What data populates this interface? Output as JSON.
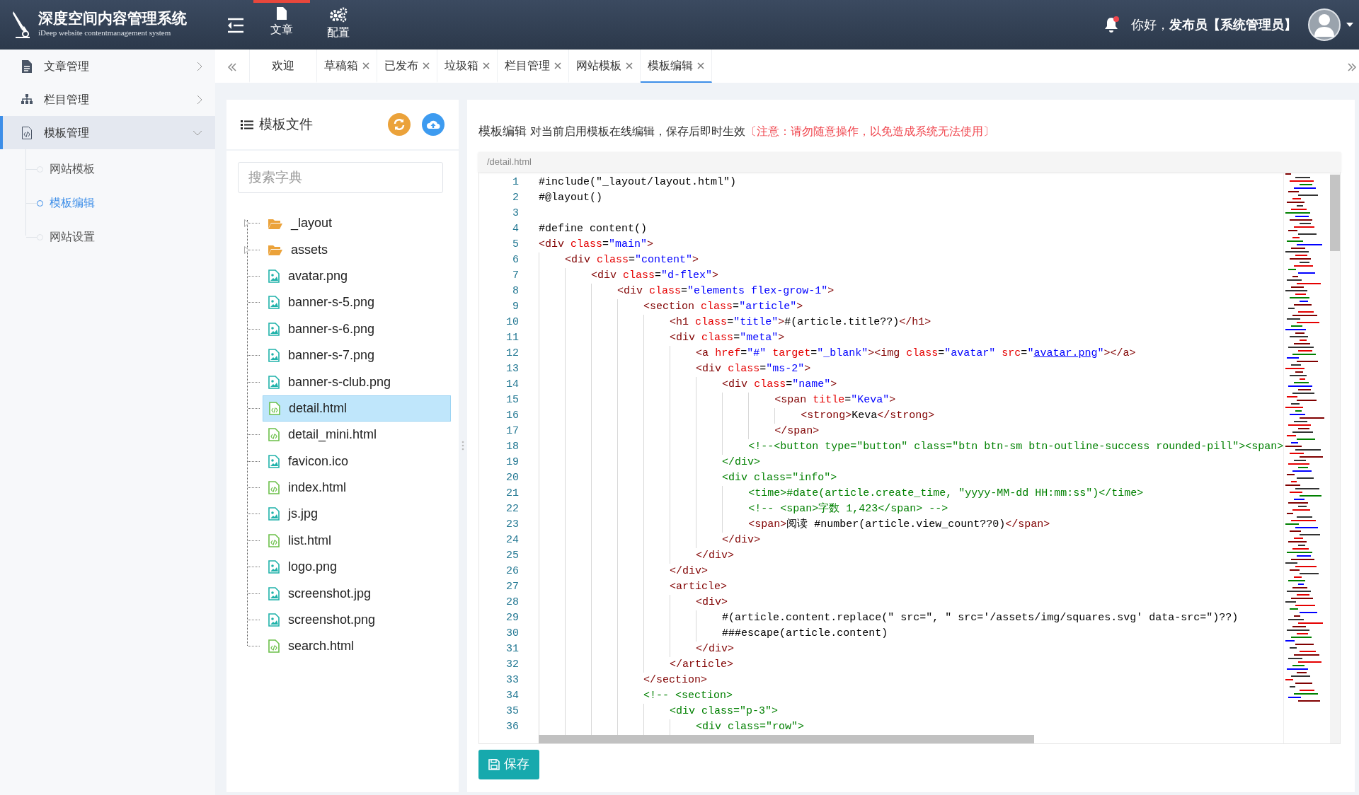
{
  "header": {
    "title": "深度空间内容管理系统",
    "subtitle": "iDeep website contentmanagement system",
    "nav": [
      {
        "label": "文章",
        "kind": "document",
        "selected": true
      },
      {
        "label": "配置",
        "kind": "gears",
        "selected": false
      }
    ],
    "notification": true,
    "greeting": "你好，**发布员【系统管理员】**"
  },
  "sidebar": {
    "items": [
      {
        "label": "文章管理",
        "kind": "document",
        "expanded": false,
        "selected": false
      },
      {
        "label": "栏目管理",
        "kind": "sitemap",
        "expanded": false,
        "selected": false
      },
      {
        "label": "模板管理",
        "kind": "code-file",
        "expanded": true,
        "selected": true,
        "children": [
          {
            "label": "网站模板",
            "selected": false
          },
          {
            "label": "模板编辑",
            "selected": true
          },
          {
            "label": "网站设置",
            "selected": false
          }
        ]
      }
    ]
  },
  "tabs": [
    {
      "label": "欢迎",
      "closable": false,
      "selected": false
    },
    {
      "label": "草稿箱",
      "closable": true,
      "selected": false
    },
    {
      "label": "已发布",
      "closable": true,
      "selected": false
    },
    {
      "label": "垃圾箱",
      "closable": true,
      "selected": false
    },
    {
      "label": "栏目管理",
      "closable": true,
      "selected": false
    },
    {
      "label": "网站模板",
      "closable": true,
      "selected": false
    },
    {
      "label": "模板编辑",
      "closable": true,
      "selected": true
    }
  ],
  "files_panel": {
    "title": "模板文件",
    "search": {
      "placeholder": "搜索字典"
    },
    "files": [
      {
        "name": "_layout",
        "kind": "folder",
        "expanded": false,
        "selected": false
      },
      {
        "name": "assets",
        "kind": "folder",
        "expanded": false,
        "selected": false
      },
      {
        "name": "avatar.png",
        "kind": "image",
        "selected": false
      },
      {
        "name": "banner-s-5.png",
        "kind": "image",
        "selected": false
      },
      {
        "name": "banner-s-6.png",
        "kind": "image",
        "selected": false
      },
      {
        "name": "banner-s-7.png",
        "kind": "image",
        "selected": false
      },
      {
        "name": "banner-s-club.png",
        "kind": "image",
        "selected": false
      },
      {
        "name": "detail.html",
        "kind": "code",
        "selected": true
      },
      {
        "name": "detail_mini.html",
        "kind": "code",
        "selected": false
      },
      {
        "name": "favicon.ico",
        "kind": "image",
        "selected": false
      },
      {
        "name": "index.html",
        "kind": "code",
        "selected": false
      },
      {
        "name": "js.jpg",
        "kind": "image",
        "selected": false
      },
      {
        "name": "list.html",
        "kind": "code",
        "selected": false
      },
      {
        "name": "logo.png",
        "kind": "image",
        "selected": false
      },
      {
        "name": "screenshot.jpg",
        "kind": "image",
        "selected": false
      },
      {
        "name": "screenshot.png",
        "kind": "image",
        "selected": false
      },
      {
        "name": "search.html",
        "kind": "code",
        "selected": false
      }
    ]
  },
  "editor": {
    "heading": "模板编辑",
    "description": "对当前启用模板在线编辑，保存后即时生效",
    "warning": "〔注意：请勿随意操作，以免造成系统无法使用〕",
    "path": "/detail.html",
    "lines": [
      {
        "n": "1",
        "code": "#include(\"_layout/layout.html\")"
      },
      {
        "n": "2",
        "code": "#@layout()"
      },
      {
        "n": "3"
      },
      {
        "n": "4",
        "code": "#define content()"
      },
      {
        "n": "5",
        "code": "<div class=\"main\">"
      },
      {
        "n": "6",
        "code": "    <div class=\"content\">"
      },
      {
        "n": "7",
        "code": "        <div class=\"d-flex\">"
      },
      {
        "n": "8",
        "code": "            <div class=\"elements flex-grow-1\">"
      },
      {
        "n": "9",
        "code": "                <section class=\"article\">"
      },
      {
        "n": "10",
        "code": "                    <h1 class=\"title\">#(article.title??)</h1>"
      },
      {
        "n": "11",
        "code": "                    <div class=\"meta\">"
      },
      {
        "n": "12",
        "code": "                        <a href=\"#\" target=\"_blank\"><img class=\"avatar\" src=\"avatar.png\"></a>"
      },
      {
        "n": "13",
        "code": "                        <div class=\"ms-2\">"
      },
      {
        "n": "14",
        "code": "                            <div class=\"name\">"
      },
      {
        "n": "15",
        "code": "                                    <span title=\"Keva\">"
      },
      {
        "n": "16",
        "code": "                                        <strong>Keva</strong>"
      },
      {
        "n": "17",
        "code": "                                    </span>"
      },
      {
        "n": "18",
        "code": "                                <!--<button type=\"button\" class=\"btn btn-sm btn-outline-success rounded-pill\"><span>"
      },
      {
        "n": "19",
        "code": "                            </div>"
      },
      {
        "n": "20",
        "code": "                            <div class=\"info\">"
      },
      {
        "n": "21",
        "code": "                                <time>#date(article.create_time, \"yyyy-MM-dd HH:mm:ss\")</time>"
      },
      {
        "n": "22",
        "code": "                                <!-- <span>字数 1,423</span> -->"
      },
      {
        "n": "23",
        "code": "                                <span>阅读 #number(article.view_count??0)</span>"
      },
      {
        "n": "24",
        "code": "                            </div>"
      },
      {
        "n": "25",
        "code": "                        </div>"
      },
      {
        "n": "26",
        "code": "                    </div>"
      },
      {
        "n": "27",
        "code": "                    <article>"
      },
      {
        "n": "28",
        "code": "                        <div>"
      },
      {
        "n": "29",
        "code": "                            #(article.content.replace(\" src=\", \" src='/assets/img/squares.svg' data-src=\")??)"
      },
      {
        "n": "30",
        "code": "                            ###escape(article.content)"
      },
      {
        "n": "31",
        "code": "                        </div>"
      },
      {
        "n": "32",
        "code": "                    </article>"
      },
      {
        "n": "33",
        "code": "                </section>"
      },
      {
        "n": "34",
        "code": "                <!-- <section>"
      },
      {
        "n": "35",
        "code": "                    <div class=\"p-3\">"
      },
      {
        "n": "36",
        "code": "                        <div class=\"row\">"
      }
    ],
    "save_button": "保存"
  }
}
